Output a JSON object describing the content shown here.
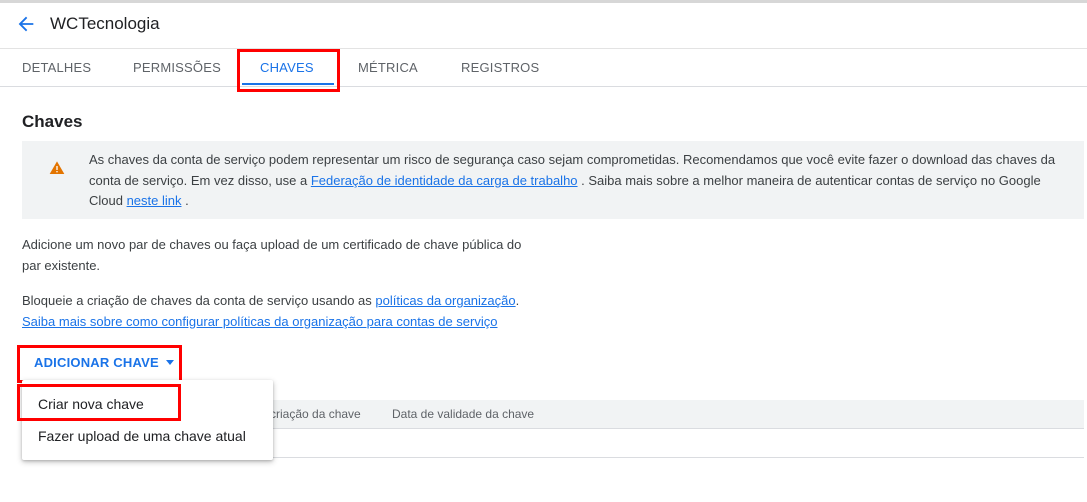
{
  "header": {
    "title": "WCTecnologia",
    "back_icon": "arrow-left-icon"
  },
  "tabs": [
    {
      "label": "DETALHES",
      "active": false
    },
    {
      "label": "PERMISSÕES",
      "active": false
    },
    {
      "label": "CHAVES",
      "active": true
    },
    {
      "label": "MÉTRICA",
      "active": false
    },
    {
      "label": "REGISTROS",
      "active": false
    }
  ],
  "section": {
    "title": "Chaves"
  },
  "alert": {
    "icon": "warning-icon",
    "text_before_link1": "As chaves da conta de serviço podem representar um risco de segurança caso sejam comprometidas. Recomendamos que você evite fazer o download das chaves da conta de serviço. Em vez disso, use a ",
    "link1": "Federação de identidade da carga de trabalho",
    "text_after_link1": " . Saiba mais sobre a melhor maneira de autenticar contas de serviço no Google Cloud ",
    "link2": "neste link",
    "text_after_link2": " ."
  },
  "para1": "Adicione um novo par de chaves ou faça upload de um certificado de chave pública do par existente.",
  "para2": {
    "text": "Bloqueie a criação de chaves da conta de serviço usando as ",
    "link1": "políticas da organização",
    "after_link1": ".",
    "link2": "Saiba mais sobre como configurar políticas da organização para contas de serviço"
  },
  "add_key_button": "ADICIONAR CHAVE",
  "table": {
    "columns": [
      "criação da chave",
      "Data de validade da chave"
    ]
  },
  "menu": {
    "items": [
      "Criar nova chave",
      "Fazer upload de uma chave atual"
    ]
  },
  "colors": {
    "accent": "#1a73e8",
    "highlight": "#ff0000",
    "warning": "#e37400"
  }
}
